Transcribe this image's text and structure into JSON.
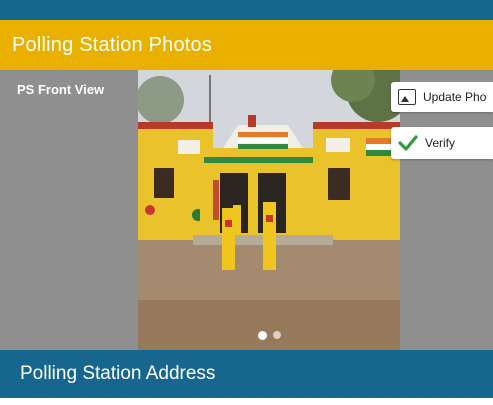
{
  "sections": {
    "photos_title": "Polling Station Photos",
    "address_title": "Polling Station Address"
  },
  "photo_card": {
    "label": "PS Front View",
    "carousel": {
      "total": 2,
      "active_index": 0
    }
  },
  "actions": {
    "update_label": "Update Pho",
    "verify_label": "Verify"
  },
  "icons": {
    "update": "image-icon",
    "verify": "checkmark-icon"
  },
  "colors": {
    "primary_blue": "#16668f",
    "header_yellow": "#e9b000",
    "panel_gray": "#8f8f8f",
    "verify_green": "#2e9e3a"
  }
}
